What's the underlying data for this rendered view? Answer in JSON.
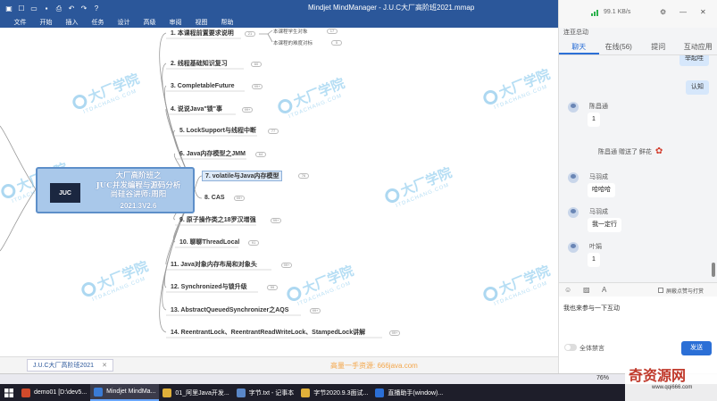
{
  "window": {
    "title": "Mindjet MindManager - J.U.C大厂高阶班2021.mmap"
  },
  "menu": [
    "文件",
    "开始",
    "插入",
    "任务",
    "设计",
    "高级",
    "审阅",
    "视图",
    "帮助"
  ],
  "map": {
    "central": {
      "logo": "JUC",
      "lines": [
        "大厂高阶班之",
        "JUC并发编程与源码分析",
        "尚硅谷讲师:周阳"
      ],
      "version": "2021.3V2.6"
    },
    "topics": [
      {
        "label": "1. 本课程前置要求说明",
        "badge": "21",
        "selected": false
      },
      {
        "label": "2. 线程基础知识复习",
        "badge": "60",
        "selected": false
      },
      {
        "label": "3. CompletableFuture",
        "badge": "99+",
        "selected": false
      },
      {
        "label": "4. 说说Java\"锁\"事",
        "badge": "99+",
        "selected": false
      },
      {
        "label": "5. LockSupport与线程中断",
        "badge": "77",
        "selected": false
      },
      {
        "label": "6. Java内存模型之JMM",
        "badge": "64",
        "selected": false
      },
      {
        "label": "7. volatile与Java内存模型",
        "badge": "76",
        "selected": true
      },
      {
        "label": "8. CAS",
        "badge": "99+",
        "selected": false
      },
      {
        "label": "9. 原子操作类之18罗汉增强",
        "badge": "99+",
        "selected": false
      },
      {
        "label": "10. 聊聊ThreadLocal",
        "badge": "91",
        "selected": false
      },
      {
        "label": "11. Java对象内存布局和对象头",
        "badge": "99+",
        "selected": false
      },
      {
        "label": "12. Synchronized与锁升级",
        "badge": "99",
        "selected": false
      },
      {
        "label": "13. AbstractQueuedSynchronizer之AQS",
        "badge": "99+",
        "selected": false
      },
      {
        "label": "14. ReentrantLock、ReentrantReadWriteLock、StampedLock讲解",
        "badge": "99+",
        "selected": false
      }
    ],
    "subtopics": [
      {
        "label": "本课程学生对象",
        "badge": "17"
      },
      {
        "label": "本课程的难度对标",
        "badge": "5"
      }
    ],
    "watermark": {
      "cn": "大厂学院",
      "en": "ITDACHANG.COM"
    }
  },
  "doc_tab": {
    "label": "J.U.C大厂高阶班2021"
  },
  "bottom_watermark": "高量一手资源: 666java.com",
  "zoom": "76%",
  "panel": {
    "speed": "99.1 KB/s",
    "link_text": "连亚总动",
    "tabs": [
      "聊天",
      "在线(56)",
      "提问",
      "互动应用"
    ],
    "active_tab": "聊天",
    "right_bubbles": [
      "举起哇",
      "认知"
    ],
    "messages": [
      {
        "name": "陈昌通",
        "text": "1"
      },
      {
        "name": "马羽成",
        "text": "哈哈哈"
      },
      {
        "name": "马羽成",
        "text": "我一定行"
      },
      {
        "name": "叶娟",
        "text": "1"
      }
    ],
    "gift": "陈昌通 赠送了 鲜花",
    "toolbar_icons": [
      "emoji-icon",
      "image-icon",
      "font-icon"
    ],
    "block_label": "屏蔽点赞与打赏",
    "input_text": "我也来参与一下互动",
    "toggle_label": "全体禁言",
    "send_label": "发送"
  },
  "taskbar": {
    "items": [
      {
        "label": "demo01 [D:\\dev5...",
        "color": "#d04a2b",
        "active": false
      },
      {
        "label": "Mindjet MindMa...",
        "color": "#3a7bd5",
        "active": true
      },
      {
        "label": "01_阿里Java开发...",
        "color": "#e0b03a",
        "active": false
      },
      {
        "label": "字节.txt - 记事本",
        "color": "#5a87c8",
        "active": false
      },
      {
        "label": "字节2020.9.3面试...",
        "color": "#e0b03a",
        "active": false
      },
      {
        "label": "直播助手(window)...",
        "color": "#2b6fd6",
        "active": false
      }
    ]
  },
  "brand": {
    "main": "奇资源网",
    "sub": "www.qqi666.com"
  }
}
